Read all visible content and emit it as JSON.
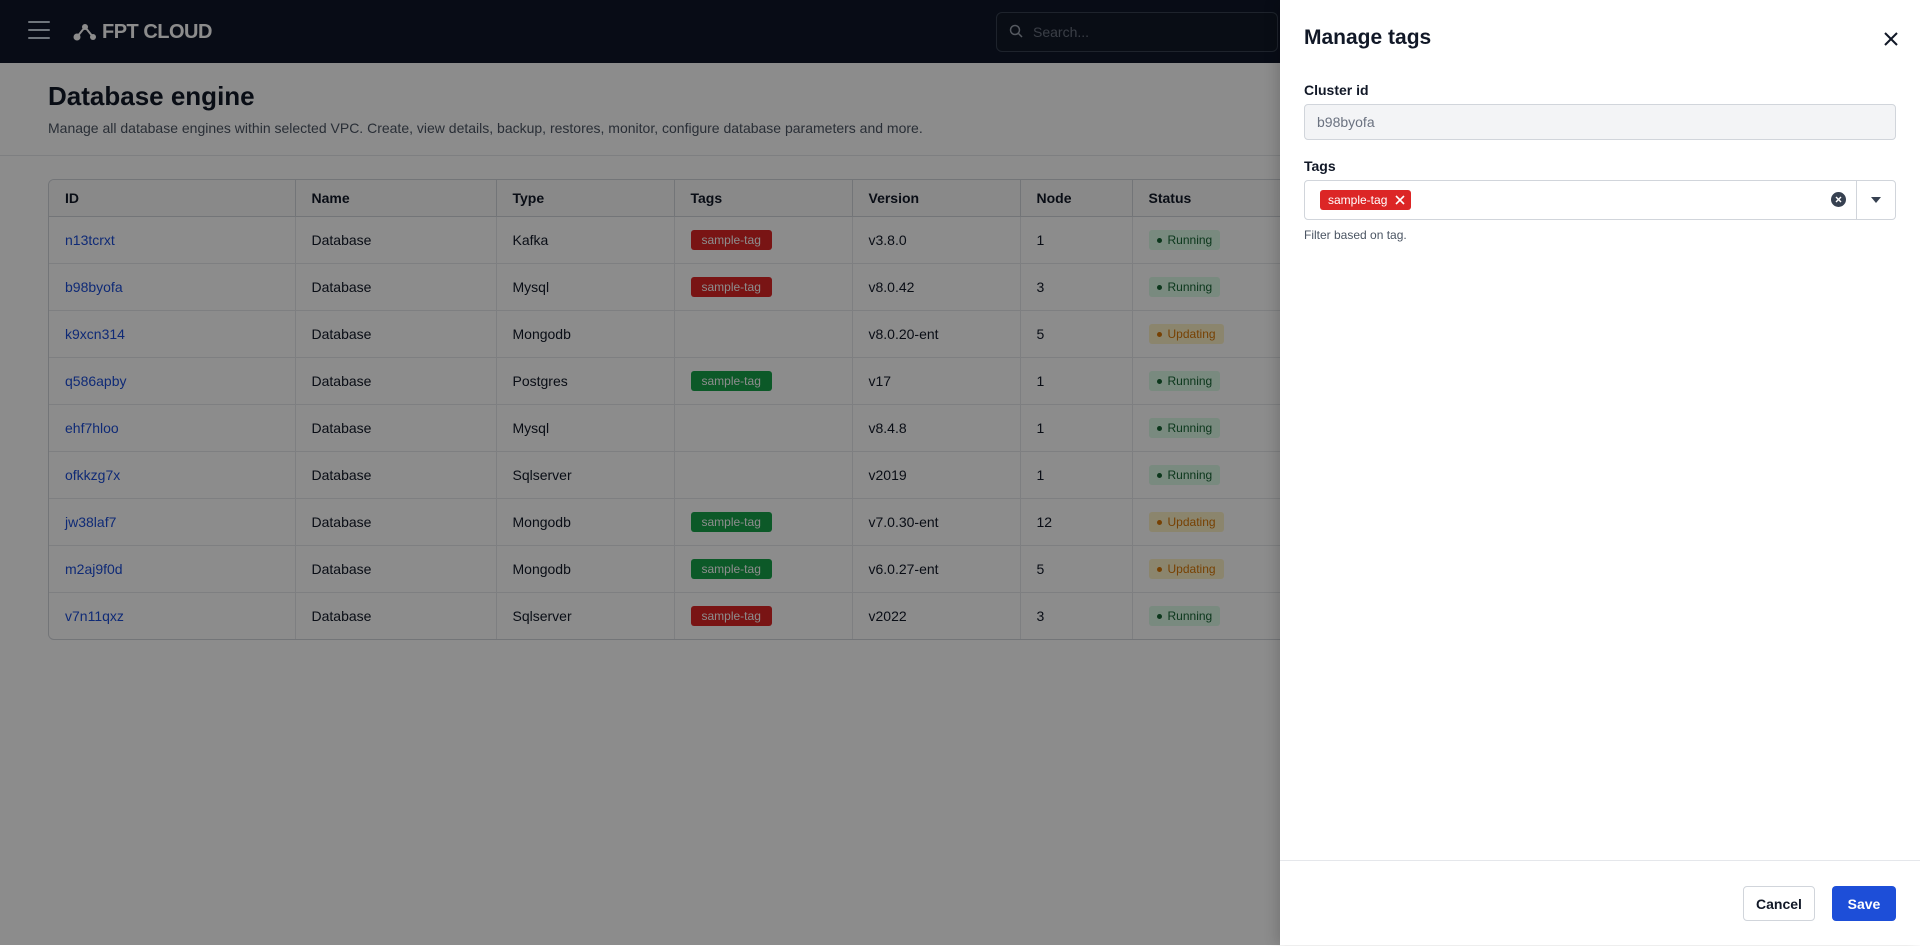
{
  "header": {
    "logo_text": "FPT CLOUD",
    "search_placeholder": "Search..."
  },
  "page": {
    "title": "Database engine",
    "subtitle": "Manage all database engines within selected VPC. Create, view details, backup, restores, monitor, configure database parameters and more."
  },
  "table": {
    "columns": [
      "ID",
      "Name",
      "Type",
      "Tags",
      "Version",
      "Node",
      "Status"
    ],
    "rows": [
      {
        "id": "n13tcrxt",
        "name": "Database",
        "type": "Kafka",
        "tag": "sample-tag",
        "tag_color": "red",
        "version": "v3.8.0",
        "node": "1",
        "status": "Running"
      },
      {
        "id": "b98byofa",
        "name": "Database",
        "type": "Mysql",
        "tag": "sample-tag",
        "tag_color": "red",
        "version": "v8.0.42",
        "node": "3",
        "status": "Running"
      },
      {
        "id": "k9xcn314",
        "name": "Database",
        "type": "Mongodb",
        "tag": "",
        "tag_color": "",
        "version": "v8.0.20-ent",
        "node": "5",
        "status": "Updating"
      },
      {
        "id": "q586apby",
        "name": "Database",
        "type": "Postgres",
        "tag": "sample-tag",
        "tag_color": "green",
        "version": "v17",
        "node": "1",
        "status": "Running"
      },
      {
        "id": "ehf7hloo",
        "name": "Database",
        "type": "Mysql",
        "tag": "",
        "tag_color": "",
        "version": "v8.4.8",
        "node": "1",
        "status": "Running"
      },
      {
        "id": "ofkkzg7x",
        "name": "Database",
        "type": "Sqlserver",
        "tag": "",
        "tag_color": "",
        "version": "v2019",
        "node": "1",
        "status": "Running"
      },
      {
        "id": "jw38laf7",
        "name": "Database",
        "type": "Mongodb",
        "tag": "sample-tag",
        "tag_color": "green",
        "version": "v7.0.30-ent",
        "node": "12",
        "status": "Updating"
      },
      {
        "id": "m2aj9f0d",
        "name": "Database",
        "type": "Mongodb",
        "tag": "sample-tag",
        "tag_color": "green",
        "version": "v6.0.27-ent",
        "node": "5",
        "status": "Updating"
      },
      {
        "id": "v7n11qxz",
        "name": "Database",
        "type": "Sqlserver",
        "tag": "sample-tag",
        "tag_color": "red",
        "version": "v2022",
        "node": "3",
        "status": "Running"
      }
    ]
  },
  "drawer": {
    "title": "Manage tags",
    "cluster_label": "Cluster id",
    "cluster_value": "b98byofa",
    "tags_label": "Tags",
    "selected_tags": [
      "sample-tag"
    ],
    "help_text": "Filter based on tag.",
    "cancel_label": "Cancel",
    "save_label": "Save"
  },
  "colors": {
    "topbar": "#0f1729",
    "tag_red": "#dc2626",
    "tag_green": "#16a34a",
    "primary": "#1d4ed8",
    "running_bg": "#dcfce7",
    "updating_bg": "#fef3c7"
  },
  "icons": [
    "menu-icon",
    "logo-icon",
    "search-icon",
    "close-icon",
    "remove-tag-icon",
    "clear-icon",
    "chevron-down-icon"
  ]
}
